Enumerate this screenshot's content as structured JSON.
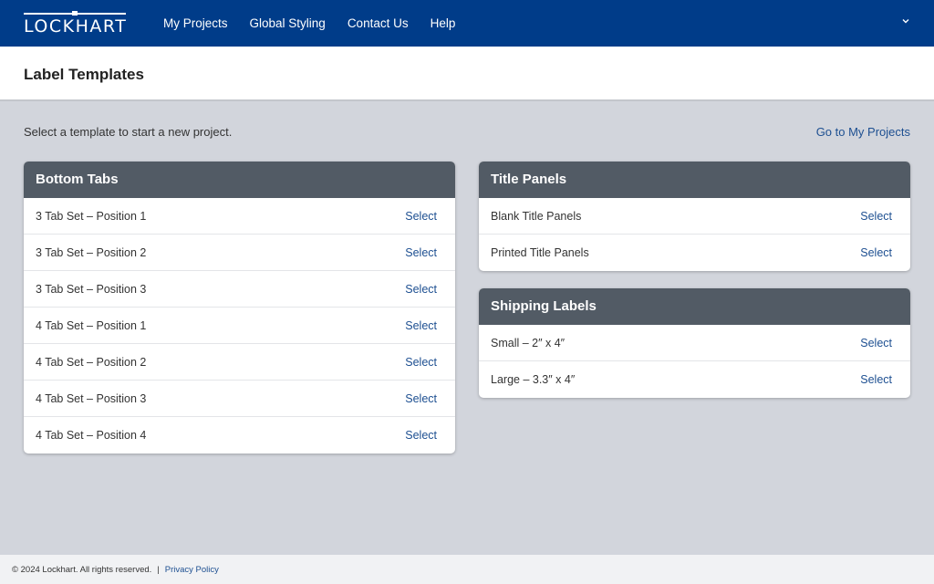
{
  "brand": {
    "logo_text": "LOCKHART"
  },
  "nav": {
    "items": [
      {
        "label": "My Projects"
      },
      {
        "label": "Global Styling"
      },
      {
        "label": "Contact Us"
      },
      {
        "label": "Help"
      }
    ],
    "menu_icon": "chevron-down-icon"
  },
  "page": {
    "title": "Label Templates",
    "intro": "Select a template to start a new project.",
    "goto_link": "Go to My Projects"
  },
  "groups": {
    "bottom_tabs": {
      "title": "Bottom Tabs",
      "items": [
        {
          "label": "3 Tab Set – Position 1",
          "action": "Select"
        },
        {
          "label": "3 Tab Set – Position 2",
          "action": "Select"
        },
        {
          "label": "3 Tab Set – Position 3",
          "action": "Select"
        },
        {
          "label": "4 Tab Set – Position 1",
          "action": "Select"
        },
        {
          "label": "4 Tab Set – Position 2",
          "action": "Select"
        },
        {
          "label": "4 Tab Set – Position 3",
          "action": "Select"
        },
        {
          "label": "4 Tab Set – Position 4",
          "action": "Select"
        }
      ]
    },
    "title_panels": {
      "title": "Title Panels",
      "items": [
        {
          "label": "Blank Title Panels",
          "action": "Select"
        },
        {
          "label": "Printed Title Panels",
          "action": "Select"
        }
      ]
    },
    "shipping_labels": {
      "title": "Shipping Labels",
      "items": [
        {
          "label": "Small – 2″ x 4″",
          "action": "Select"
        },
        {
          "label": "Large – 3.3″ x 4″",
          "action": "Select"
        }
      ]
    }
  },
  "footer": {
    "copyright": "© 2024 Lockhart. All rights reserved.",
    "separator": "|",
    "privacy": "Privacy Policy"
  },
  "colors": {
    "nav_bg": "#003c89",
    "card_header_bg": "#525b65",
    "link": "#1d4f91",
    "page_bg": "#d2d5dc"
  }
}
